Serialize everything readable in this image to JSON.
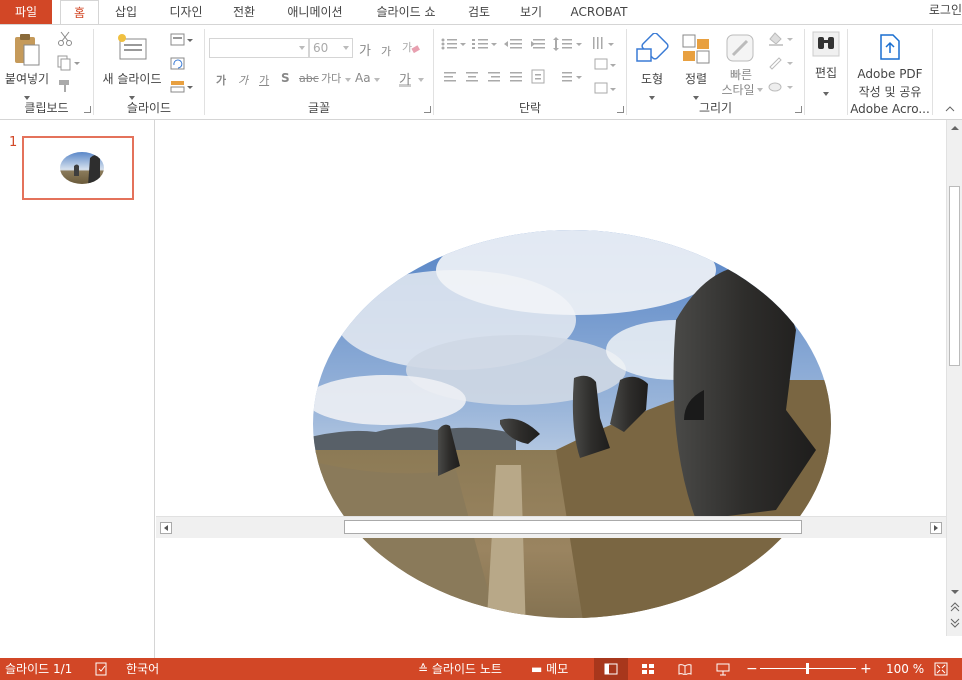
{
  "tabs": {
    "file": "파일",
    "home": "홈",
    "insert": "삽입",
    "design": "디자인",
    "transitions": "전환",
    "animations": "애니메이션",
    "slideshow": "슬라이드 쇼",
    "review": "검토",
    "view": "보기",
    "acrobat": "ACROBAT"
  },
  "login": "로그인",
  "ribbon": {
    "clipboard": {
      "label": "클립보드",
      "paste": "붙여넣기"
    },
    "slides": {
      "label": "슬라이드",
      "new_slide": "새 슬라이드"
    },
    "font": {
      "label": "글꼴",
      "font_name": "",
      "font_size": "60"
    },
    "paragraph": {
      "label": "단락"
    },
    "drawing": {
      "label": "그리기",
      "shapes": "도형",
      "arrange": "정렬",
      "quick_styles_1": "빠른",
      "quick_styles_2": "스타일"
    },
    "editing": {
      "label": "편집"
    },
    "adobe": {
      "label": "Adobe Acro...",
      "create_1": "Adobe PDF",
      "create_2": "작성 및 공유"
    }
  },
  "thumbnails": {
    "number": "1"
  },
  "status": {
    "slide_count": "슬라이드 1/1",
    "language": "한국어",
    "notes": "슬라이드 노트",
    "comments": "메모",
    "zoom": "100 %"
  },
  "colors": {
    "accent": "#d24726",
    "thumb_border": "#e4725b"
  }
}
